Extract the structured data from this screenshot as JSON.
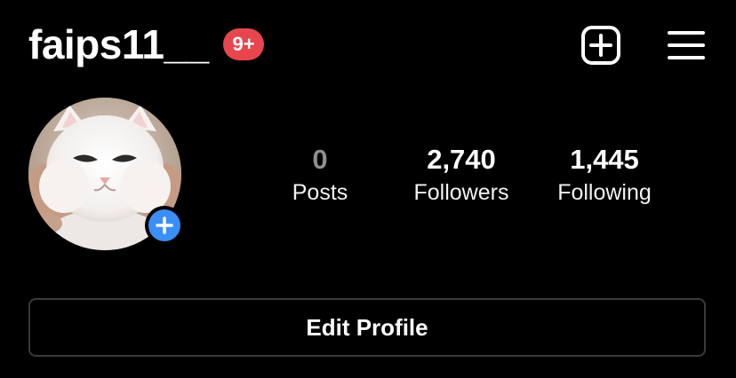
{
  "header": {
    "username": "faips11__",
    "notification_badge": "9+",
    "badge_color": "#e8464f",
    "new_post_icon": "plus-square-icon",
    "menu_icon": "hamburger-menu-icon"
  },
  "profile": {
    "avatar": "cat-profile-photo",
    "add_story_icon": "plus-icon",
    "add_story_color": "#3b8ef5"
  },
  "stats": [
    {
      "value": "0",
      "label": "Posts"
    },
    {
      "value": "2,740",
      "label": "Followers"
    },
    {
      "value": "1,445",
      "label": "Following"
    }
  ],
  "actions": {
    "edit_profile_label": "Edit Profile"
  }
}
